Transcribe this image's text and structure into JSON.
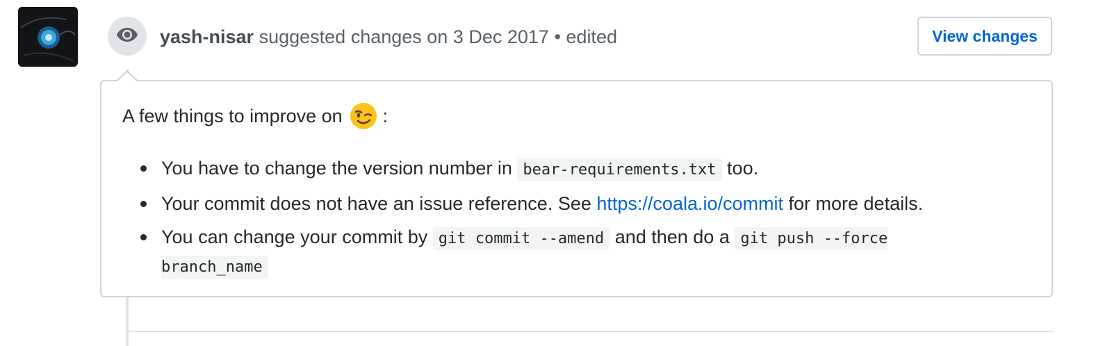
{
  "review": {
    "author": "yash-nisar",
    "action_text": "suggested changes on 3 Dec 2017",
    "separator": "•",
    "edited_label": "edited",
    "view_changes_label": "View changes"
  },
  "comment": {
    "intro_text": "A few things to improve on",
    "intro_suffix": ":",
    "items": [
      {
        "pre": "You have to change the version number in",
        "code": "bear-requirements.txt",
        "post": "too."
      },
      {
        "pre": "Your commit does not have an issue reference. See",
        "link": "https://coala.io/commit",
        "post": "for more details."
      },
      {
        "pre": "You can change your commit by",
        "code1": "git commit --amend",
        "mid": "and then do a",
        "code2": "git push --force branch_name"
      }
    ]
  },
  "icons": {
    "badge": "eye-icon",
    "emoji": "winking-face-emoji"
  },
  "colors": {
    "link": "#0366d6",
    "border": "#d1d5da",
    "timeline": "#e1e4e8",
    "code_bg": "#f3f4f4",
    "emoji": "#fcc21b"
  }
}
